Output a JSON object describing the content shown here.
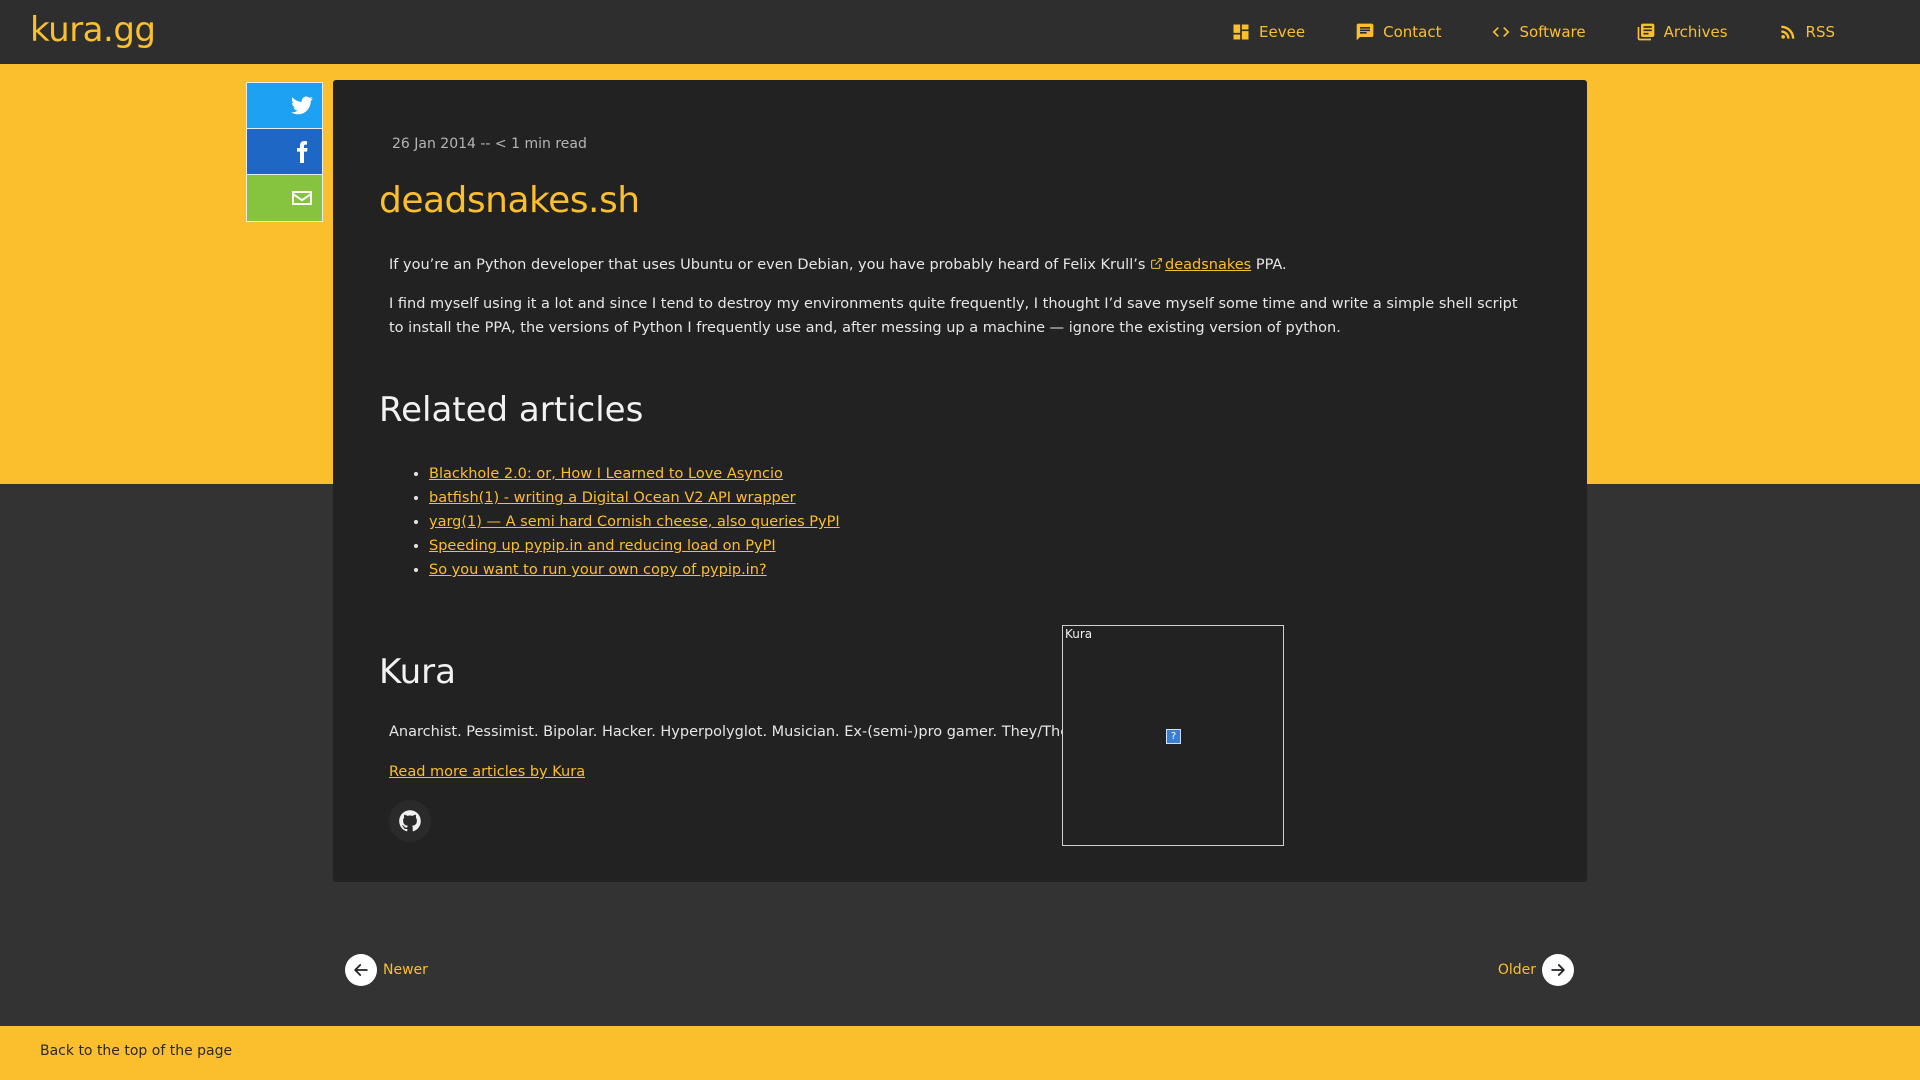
{
  "site": {
    "logo": "kura.gg"
  },
  "nav": {
    "items": [
      {
        "label": "Eevee",
        "icon": "dashboard-icon"
      },
      {
        "label": "Contact",
        "icon": "chat-icon"
      },
      {
        "label": "Software",
        "icon": "code-icon"
      },
      {
        "label": "Archives",
        "icon": "library-icon"
      },
      {
        "label": "RSS",
        "icon": "rss-icon"
      }
    ]
  },
  "share": {
    "items": [
      {
        "name": "twitter",
        "icon": "twitter-icon",
        "color": "#1da1f2"
      },
      {
        "name": "facebook",
        "icon": "facebook-icon",
        "color": "#1f67c4"
      },
      {
        "name": "email",
        "icon": "mail-icon",
        "color": "#86c440"
      }
    ]
  },
  "article": {
    "meta": "26 Jan 2014 -- < 1 min read",
    "title": "deadsnakes.sh",
    "p1_before": "If you’re an Python developer that uses Ubuntu or even Debian, you have probably heard of Felix Krull’s ",
    "p1_link": "deadsnakes",
    "p1_after": " PPA.",
    "p2": "I find myself using it a lot and since I tend to destroy my environments quite frequently, I thought I’d save myself some time and write a simple shell script to install the PPA, the versions of Python I frequently use and, after messing up a machine — ignore the existing version of python."
  },
  "related": {
    "heading": "Related articles",
    "links": [
      "Blackhole 2.0: or, How I Learned to Love Asyncio",
      "batfish(1) - writing a Digital Ocean V2 API wrapper",
      "yarg(1) — A semi hard Cornish cheese, also queries PyPI",
      "Speeding up pypip.in and reducing load on PyPI",
      "So you want to run your own copy of pypip.in?"
    ]
  },
  "author": {
    "name": "Kura",
    "bio": "Anarchist. Pessimist. Bipolar. Hacker. Hyperpolyglot. Musician. Ex-(semi-)pro gamer. They/Them.",
    "more": "Read more articles by Kura",
    "avatar_alt": "Kura",
    "avatar_broken": "?"
  },
  "pager": {
    "newer": "Newer",
    "older": "Older"
  },
  "footer": {
    "back_to_top": "Back to the top of the page"
  },
  "colors": {
    "accent": "#fbbf2e",
    "background": "#333333",
    "card": "#222222"
  }
}
